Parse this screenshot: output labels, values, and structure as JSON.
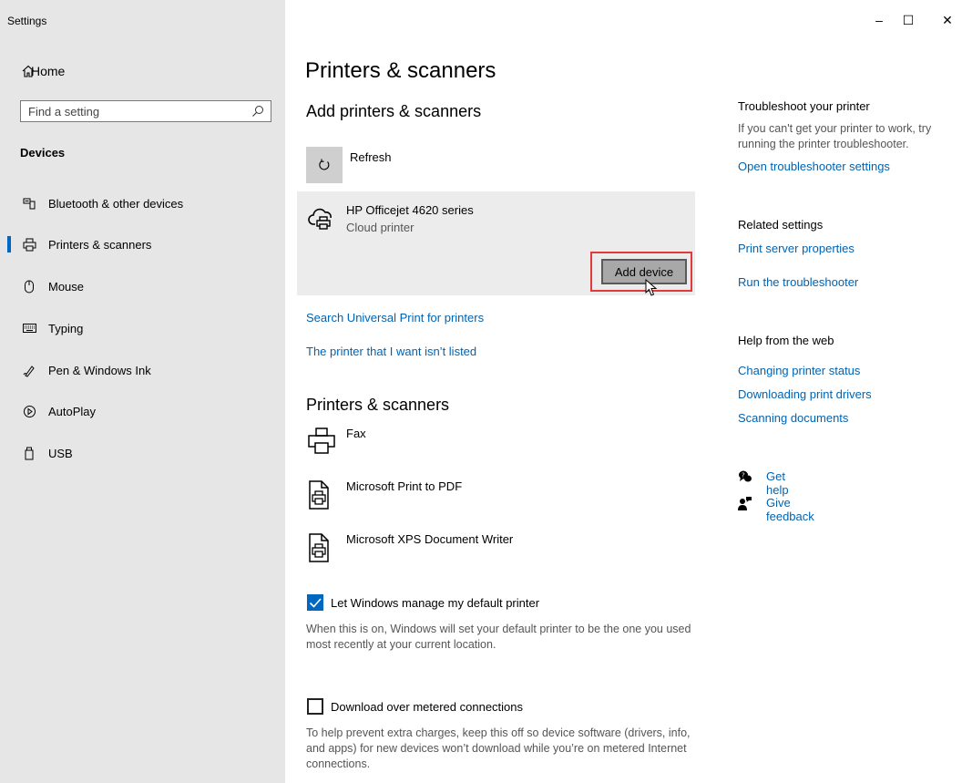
{
  "window": {
    "title": "Settings",
    "controls": {
      "minimize": "–",
      "maximize": "☐",
      "close": "✕"
    }
  },
  "sidebar": {
    "home_label": "Home",
    "search_placeholder": "Find a setting",
    "section_heading": "Devices",
    "items": [
      {
        "label": "Bluetooth & other devices",
        "icon": "bluetooth-devices-icon",
        "selected": false
      },
      {
        "label": "Printers & scanners",
        "icon": "printer-icon",
        "selected": true
      },
      {
        "label": "Mouse",
        "icon": "mouse-icon",
        "selected": false
      },
      {
        "label": "Typing",
        "icon": "keyboard-icon",
        "selected": false
      },
      {
        "label": "Pen & Windows Ink",
        "icon": "pen-icon",
        "selected": false
      },
      {
        "label": "AutoPlay",
        "icon": "autoplay-icon",
        "selected": false
      },
      {
        "label": "USB",
        "icon": "usb-icon",
        "selected": false
      }
    ]
  },
  "main": {
    "page_title": "Printers & scanners",
    "add_section": {
      "heading": "Add printers & scanners",
      "refresh_label": "Refresh",
      "found_device": {
        "name": "HP Officejet 4620 series",
        "subtitle": "Cloud printer",
        "add_button_label": "Add device"
      },
      "links": [
        "Search Universal Print for printers",
        "The printer that I want isn’t listed"
      ]
    },
    "printers_section": {
      "heading": "Printers & scanners",
      "printers": [
        {
          "name": "Fax",
          "icon": "fax-printer-icon"
        },
        {
          "name": "Microsoft Print to PDF",
          "icon": "document-printer-icon"
        },
        {
          "name": "Microsoft XPS Document Writer",
          "icon": "document-printer-icon"
        }
      ]
    },
    "default_printer": {
      "label": "Let Windows manage my default printer",
      "checked": true,
      "description": "When this is on, Windows will set your default printer to be the one you used most recently at your current location."
    },
    "metered": {
      "label": "Download over metered connections",
      "checked": false,
      "description": "To help prevent extra charges, keep this off so device software (drivers, info, and apps) for new devices won’t download while you’re on metered Internet connections."
    }
  },
  "right_panel": {
    "troubleshoot": {
      "heading": "Troubleshoot your printer",
      "text": "If you can't get your printer to work, try running the printer troubleshooter.",
      "link": "Open troubleshooter settings"
    },
    "related": {
      "heading": "Related settings",
      "links": [
        "Print server properties",
        "Run the troubleshooter"
      ]
    },
    "web_help": {
      "heading": "Help from the web",
      "links": [
        "Changing printer status",
        "Downloading print drivers",
        "Scanning documents"
      ]
    },
    "support": {
      "get_help": "Get help",
      "give_feedback": "Give feedback"
    }
  },
  "colors": {
    "accent": "#0067c0",
    "link": "#0063b1",
    "sidebar_bg": "#e6e6e6",
    "highlight": "#e03a3a"
  }
}
